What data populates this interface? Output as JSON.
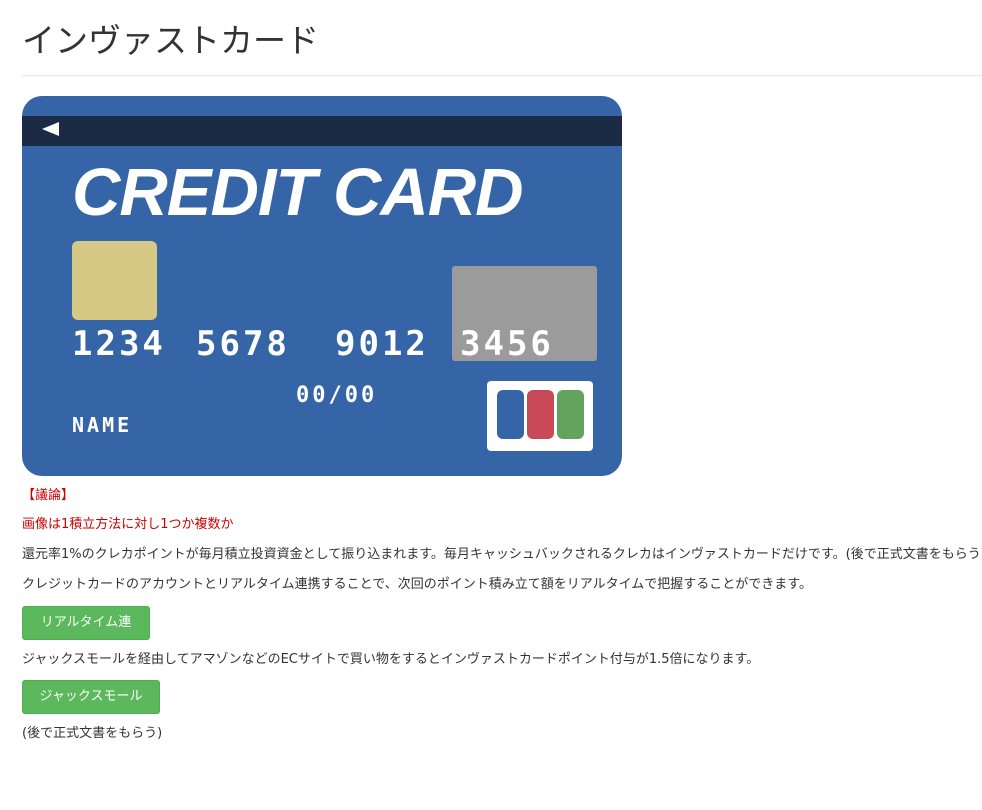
{
  "page": {
    "title": "インヴァストカード"
  },
  "card_image": {
    "heading": "CREDIT CARD",
    "number_groups": [
      "1234",
      "5678",
      "9012",
      "3456"
    ],
    "expiry": "00/00",
    "holder": "NAME",
    "colors": {
      "body": "#3565a6",
      "stripe": "#1b2a45",
      "chip": "#d5c985",
      "signature_box": "#9b9b9b",
      "logo_blue": "#3565a6",
      "logo_red": "#c84957",
      "logo_green": "#62a45e"
    }
  },
  "content": {
    "note_label": "【議論】",
    "note_text": "画像は1積立方法に対し1つか複数か",
    "paragraph_1": "還元率1%のクレカポイントが毎月積立投資資金として振り込まれます。毎月キャッシュバックされるクレカはインヴァストカードだけです。(後で正式文書をもらう)",
    "paragraph_2": "クレジットカードのアカウントとリアルタイム連携することで、次回のポイント積み立て額をリアルタイムで把握することができます。",
    "button_realtime": "リアルタイム連携",
    "paragraph_3": "ジャックスモールを経由してアマゾンなどのECサイトで買い物をするとインヴァストカードポイント付与が1.5倍になります。",
    "button_jacks": "ジャックスモールへ",
    "footer_note": "(後で正式文書をもらう)"
  },
  "colors": {
    "accent_green": "#5cb85c",
    "warning_red": "#cc0000",
    "text": "#333333"
  }
}
